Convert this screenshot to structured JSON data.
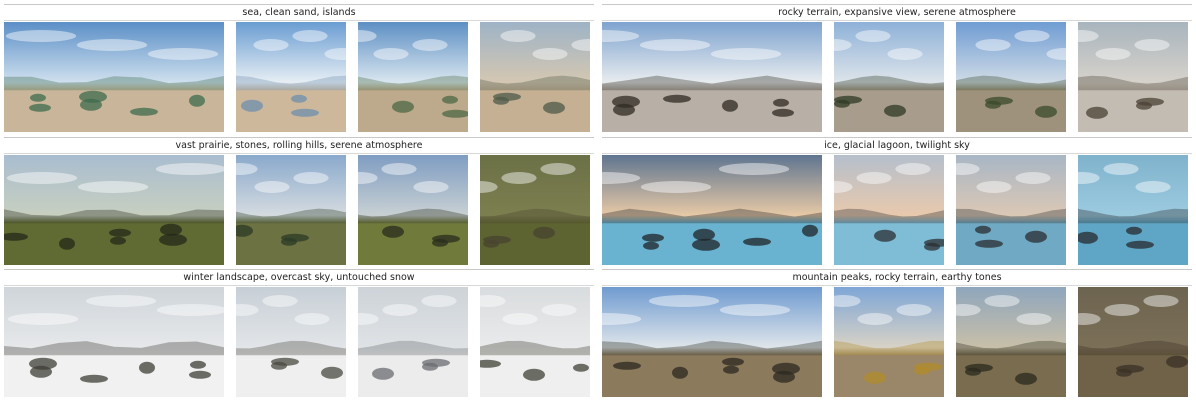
{
  "groups": [
    {
      "caption": "sea, clean sand, islands",
      "panorama": {
        "sky": "#5b8fc7",
        "horizon": "#cfe0ee",
        "ground": "#c9b69a",
        "accent": "#3f6b4d"
      },
      "views": [
        {
          "sky": "#6a9dd2",
          "horizon": "#e7eef4",
          "ground": "#cdb89b",
          "accent": "#6e8fae"
        },
        {
          "sky": "#5d8fc4",
          "horizon": "#d9e6ef",
          "ground": "#bda98b",
          "accent": "#4d6a45"
        },
        {
          "sky": "#9eb3c6",
          "horizon": "#d4c7b2",
          "ground": "#c5b094",
          "accent": "#4d5a48"
        }
      ]
    },
    {
      "caption": "rocky terrain, expansive view, serene atmosphere",
      "panorama": {
        "sky": "#7ea3cf",
        "horizon": "#e8ecef",
        "ground": "#b8b0a6",
        "accent": "#2f2a22"
      },
      "views": [
        {
          "sky": "#8eb1d8",
          "horizon": "#dde4ea",
          "ground": "#a89d8c",
          "accent": "#2e3a24"
        },
        {
          "sky": "#6f9cd3",
          "horizon": "#cfdbe6",
          "ground": "#9f927c",
          "accent": "#3a4a2a"
        },
        {
          "sky": "#a8b4bd",
          "horizon": "#d6d2cb",
          "ground": "#c3bcb2",
          "accent": "#4b4234"
        }
      ]
    },
    {
      "caption": "vast prairie, stones, rolling hills, serene atmosphere",
      "panorama": {
        "sky": "#a9bdd0",
        "horizon": "#c7cfc0",
        "ground": "#5f6b32",
        "accent": "#24281a"
      },
      "views": [
        {
          "sky": "#8aa9cc",
          "horizon": "#d5dbe0",
          "ground": "#6d7242",
          "accent": "#2b3b25"
        },
        {
          "sky": "#7f9dc2",
          "horizon": "#c8d0d3",
          "ground": "#707a3a",
          "accent": "#2a2d1e"
        },
        {
          "sky": "#6b7046",
          "horizon": "#7c7f4f",
          "ground": "#5d6431",
          "accent": "#48432f"
        }
      ]
    },
    {
      "caption": "ice, glacial lagoon, twilight sky",
      "panorama": {
        "sky": "#5f7590",
        "horizon": "#e7c9a6",
        "ground": "#69b3d1",
        "accent": "#1f2327"
      },
      "views": [
        {
          "sky": "#b5bfcc",
          "horizon": "#e8c9ad",
          "ground": "#7fbdd6",
          "accent": "#2b2f33"
        },
        {
          "sky": "#a8b6c5",
          "horizon": "#dbc8b5",
          "ground": "#6fa9c3",
          "accent": "#2a2e31"
        },
        {
          "sky": "#7fb2cc",
          "horizon": "#9ccbe0",
          "ground": "#5fa6c6",
          "accent": "#25292c"
        }
      ]
    },
    {
      "caption": "winter landscape, overcast sky, untouched snow",
      "panorama": {
        "sky": "#cfd5da",
        "horizon": "#e6e8ea",
        "ground": "#f1f1f1",
        "accent": "#3d3d36"
      },
      "views": [
        {
          "sky": "#c7cfd6",
          "horizon": "#e2e5e8",
          "ground": "#efefef",
          "accent": "#4a4a42"
        },
        {
          "sky": "#cdd3d8",
          "horizon": "#dfe2e5",
          "ground": "#ececec",
          "accent": "#6a6c70"
        },
        {
          "sky": "#d9dcde",
          "horizon": "#e9eaeb",
          "ground": "#efefef",
          "accent": "#3f4034"
        }
      ]
    },
    {
      "caption": "mountain peaks, rocky terrain, earthy tones",
      "panorama": {
        "sky": "#6f9bd0",
        "horizon": "#dfe5ea",
        "ground": "#8b7a5c",
        "accent": "#2c2a20"
      },
      "views": [
        {
          "sky": "#7ea6d6",
          "horizon": "#d8d2c6",
          "ground": "#9a8769",
          "accent": "#b08b2a"
        },
        {
          "sky": "#8fa6bd",
          "horizon": "#c8bfa8",
          "ground": "#7a6c4f",
          "accent": "#2b2a1d"
        },
        {
          "sky": "#6d6450",
          "horizon": "#7b6f57",
          "ground": "#6f6248",
          "accent": "#3a3226"
        }
      ]
    }
  ]
}
